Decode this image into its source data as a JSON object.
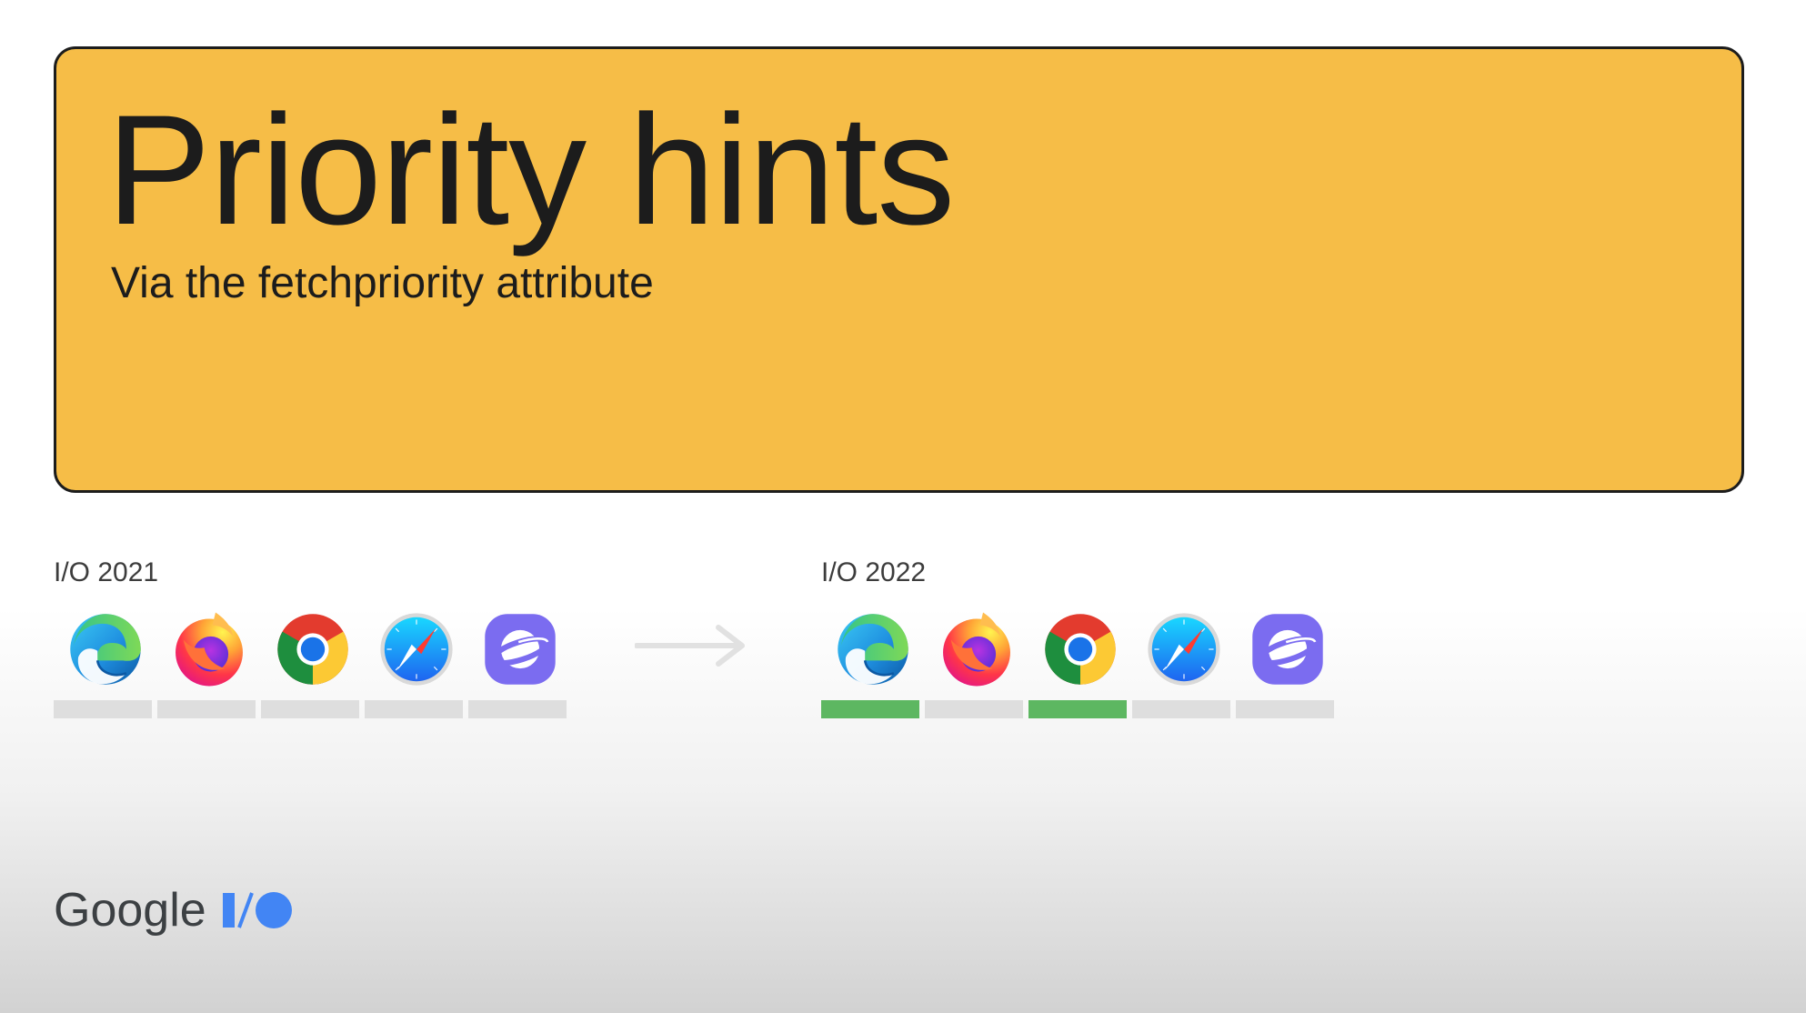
{
  "title": "Priority hints",
  "subtitle": "Via the fetchpriority attribute",
  "groups": [
    {
      "label": "I/O 2021",
      "browsers": [
        {
          "icon": "edge-icon",
          "supported": false
        },
        {
          "icon": "firefox-icon",
          "supported": false
        },
        {
          "icon": "chrome-icon",
          "supported": false
        },
        {
          "icon": "safari-icon",
          "supported": false
        },
        {
          "icon": "samsung-internet-icon",
          "supported": false
        }
      ]
    },
    {
      "label": "I/O 2022",
      "browsers": [
        {
          "icon": "edge-icon",
          "supported": true
        },
        {
          "icon": "firefox-icon",
          "supported": false
        },
        {
          "icon": "chrome-icon",
          "supported": true
        },
        {
          "icon": "safari-icon",
          "supported": false
        },
        {
          "icon": "samsung-internet-icon",
          "supported": false
        }
      ]
    }
  ],
  "footer": {
    "brand": "Google",
    "logo": "google-io-logo"
  },
  "colors": {
    "card": "#f6bd47",
    "supported": "#5db761",
    "unsupported": "#dedede",
    "arrow": "#e1e1e1",
    "io_blue": "#4285f4"
  }
}
